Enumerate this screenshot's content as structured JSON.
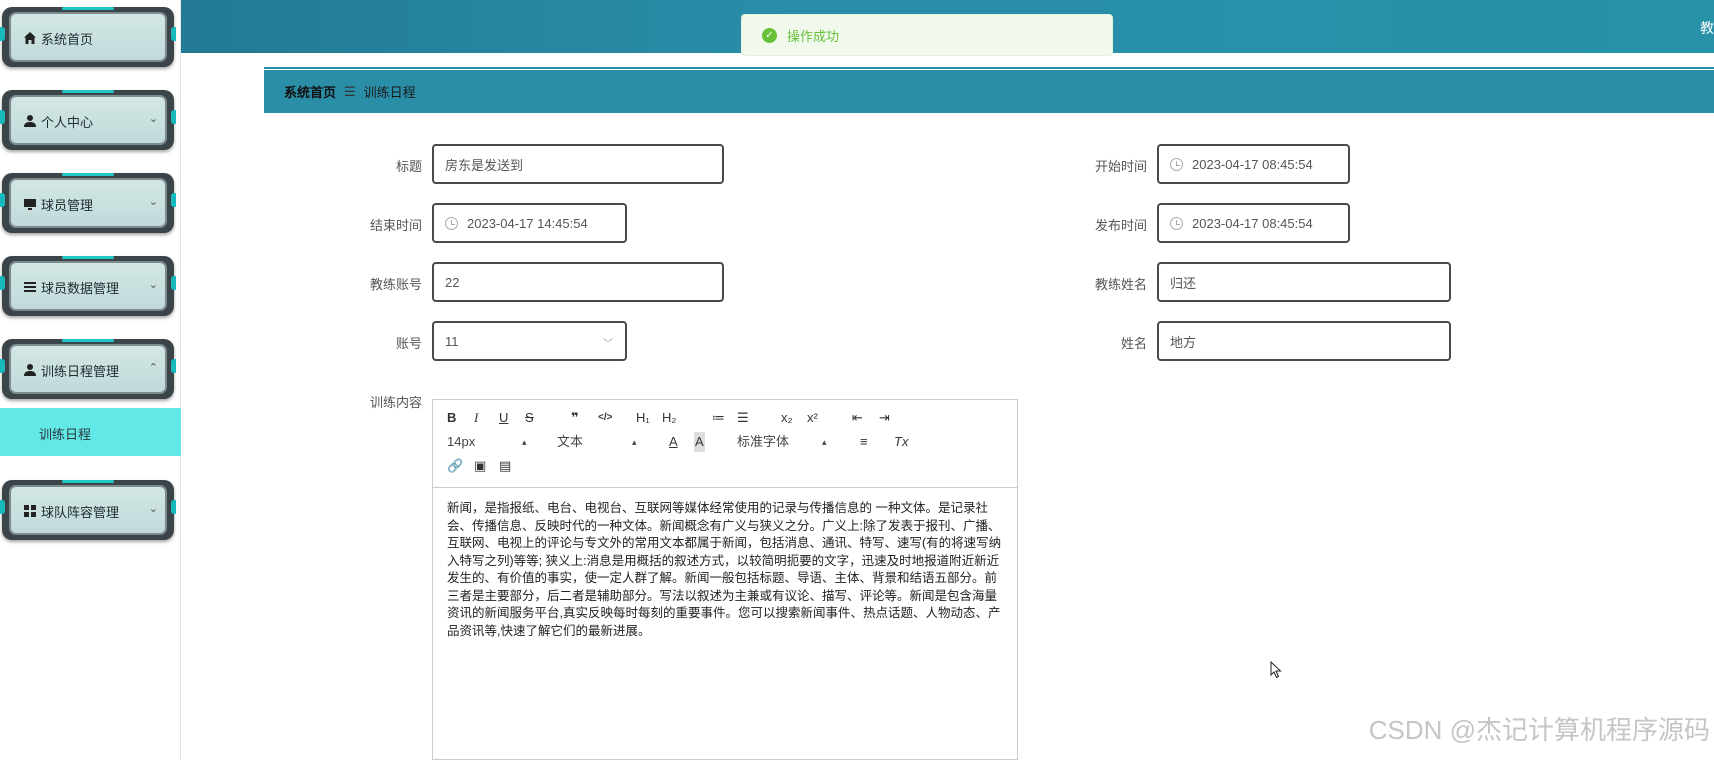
{
  "sidebar": {
    "items": [
      {
        "label": "系统首页",
        "icon": "home-icon",
        "expandable": false
      },
      {
        "label": "个人中心",
        "icon": "user-icon",
        "expandable": true
      },
      {
        "label": "球员管理",
        "icon": "monitor-icon",
        "expandable": true
      },
      {
        "label": "球员数据管理",
        "icon": "list-icon",
        "expandable": true
      },
      {
        "label": "训练日程管理",
        "icon": "user-icon",
        "expandable": true,
        "expanded": true
      },
      {
        "label": "球队阵容管理",
        "icon": "grid-icon",
        "expandable": true
      }
    ],
    "submenu_active": "训练日程"
  },
  "topbar": {
    "right_text": "教"
  },
  "toast": {
    "message": "操作成功",
    "color": "#67c23a"
  },
  "breadcrumb": {
    "home": "系统首页",
    "separator": "☰",
    "current": "训练日程"
  },
  "form": {
    "title_label": "标题",
    "title_value": "房东是发送到",
    "start_label": "开始时间",
    "start_value": "2023-04-17 08:45:54",
    "end_label": "结束时间",
    "end_value": "2023-04-17 14:45:54",
    "publish_label": "发布时间",
    "publish_value": "2023-04-17 08:45:54",
    "coach_account_label": "教练账号",
    "coach_account_value": "22",
    "coach_name_label": "教练姓名",
    "coach_name_value": "归还",
    "account_label": "账号",
    "account_value": "11",
    "name_label": "姓名",
    "name_value": "地方",
    "content_label": "训练内容"
  },
  "editor": {
    "toolbar": {
      "bold": "B",
      "italic": "I",
      "underline": "U",
      "strike": "S",
      "blockquote": "❞",
      "code": "</>",
      "h1": "H₁",
      "h2": "H₂",
      "ordered_list": "≔",
      "bullet_list": "☰",
      "subscript": "x₂",
      "superscript": "x²",
      "outdent": "⇤",
      "indent": "⇥",
      "font_size": "14px",
      "text_type": "文本",
      "font_color": "A",
      "bg_color": "A",
      "font_family": "标准字体",
      "align": "≡",
      "clear": "Tx",
      "link": "🔗",
      "image": "▣",
      "video": "▤"
    },
    "content": "新闻，是指报纸、电台、电视台、互联网等媒体经常使用的记录与传播信息的 一种文体。是记录社会、传播信息、反映时代的一种文体。新闻概念有广义与狭义之分。广义上:除了发表于报刊、广播、互联网、电视上的评论与专文外的常用文本都属于新闻，包括消息、通讯、特写、速写(有的将速写纳入特写之列)等等; 狭义上:消息是用概括的叙述方式，以较简明扼要的文字，迅速及时地报道附近新近发生的、有价值的事实，使一定人群了解。新闻一般包括标题、导语、主体、背景和结语五部分。前三者是主要部分，后二者是辅助部分。写法以叙述为主兼或有议论、描写、评论等。新闻是包含海量资讯的新闻服务平台,真实反映每时每刻的重要事件。您可以搜索新闻事件、热点话题、人物动态、产品资讯等,快速了解它们的最新进展。"
  },
  "watermark": "CSDN @杰记计算机程序源码"
}
